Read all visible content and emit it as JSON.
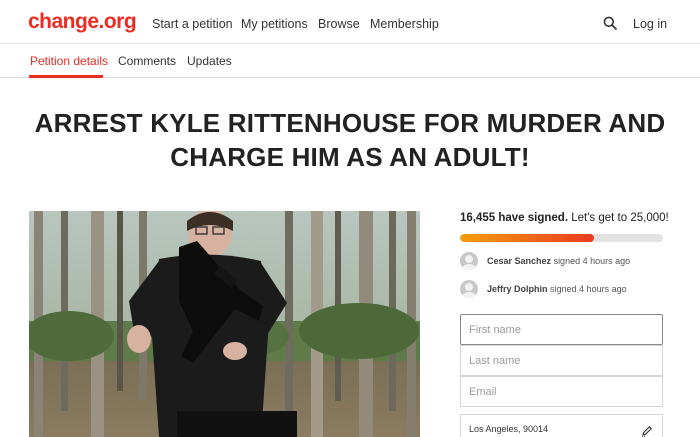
{
  "header": {
    "logo": "change.org",
    "nav": [
      "Start a petition",
      "My petitions",
      "Browse",
      "Membership"
    ],
    "login": "Log in",
    "search_icon": "search-icon"
  },
  "tabs": {
    "items": [
      "Petition details",
      "Comments",
      "Updates"
    ],
    "active": "Petition details"
  },
  "petition": {
    "title_line1": "ARREST KYLE RITTENHOUSE FOR MURDER AND",
    "title_line2": "CHARGE HIM AS AN ADULT!"
  },
  "sidebar": {
    "signed_count": "16,455 have signed.",
    "goal_text": "Let's get to 25,000!",
    "progress_fraction": 0.66,
    "progress_colors": [
      "#f59e0b",
      "#ea3a1f"
    ],
    "signers": [
      {
        "name": "Cesar Sanchez",
        "action": "signed 4 hours ago"
      },
      {
        "name": "Jeffry Dolphin",
        "action": "signed 4 hours ago"
      }
    ],
    "form": {
      "first_name_placeholder": "First name",
      "last_name_placeholder": "Last name",
      "email_placeholder": "Email",
      "location": "Los Angeles, 90014"
    }
  },
  "colors": {
    "brand": "#ec2c22"
  }
}
